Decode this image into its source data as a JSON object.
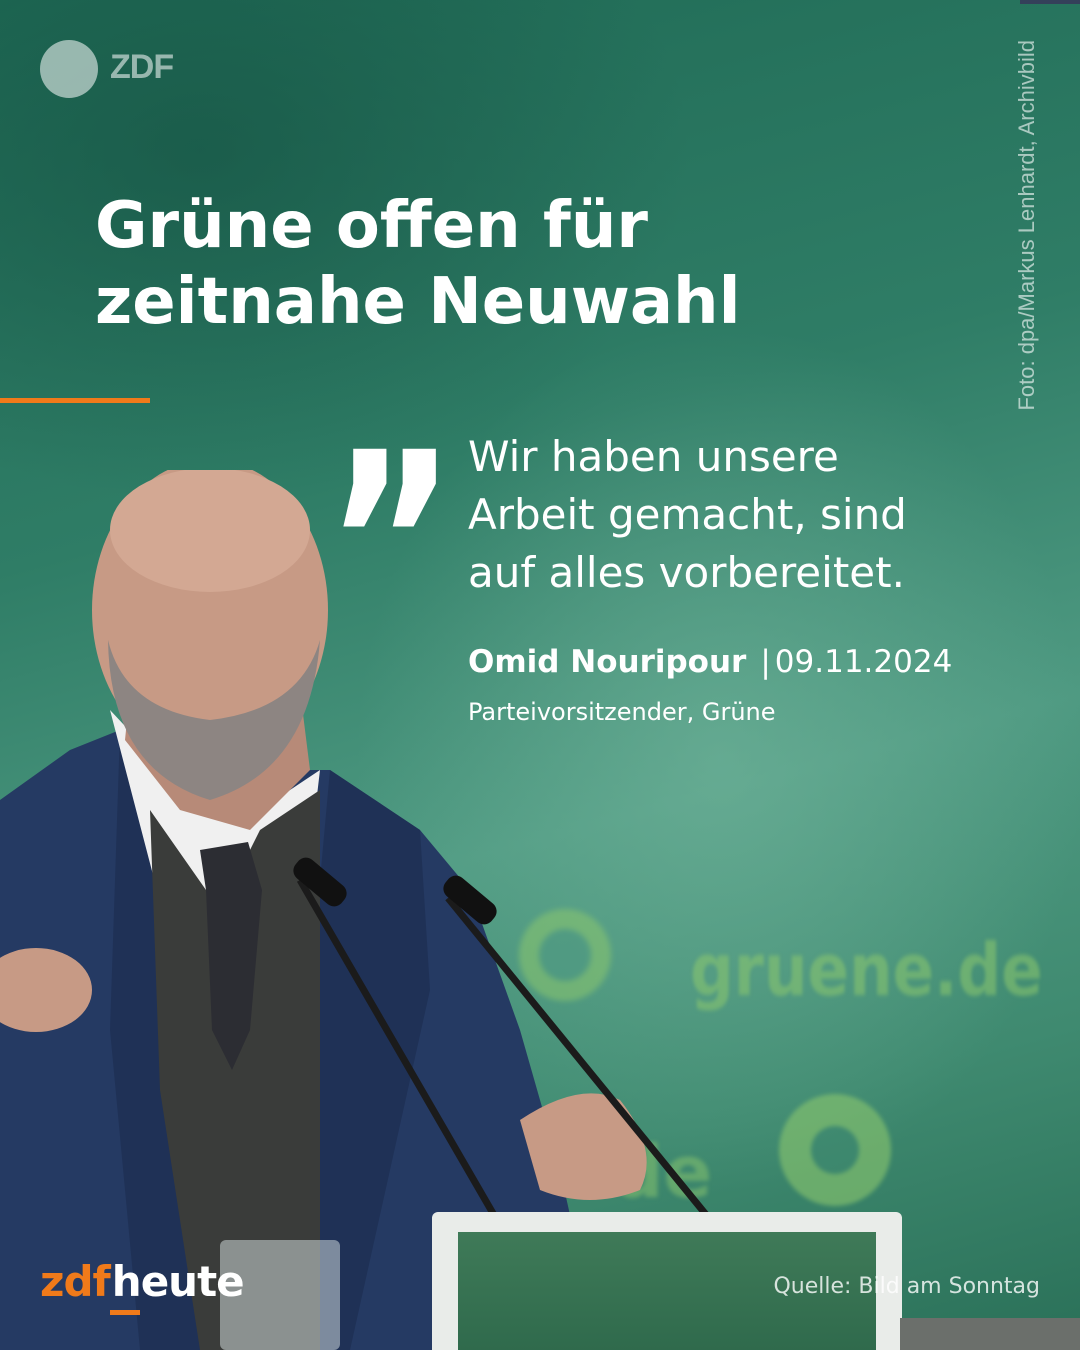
{
  "logo": {
    "letters": "ZDF"
  },
  "photo_credit": "Foto: dpa/Markus Lenhardt, Archivbild",
  "headline": {
    "line1": "Grüne offen für",
    "line2": "zeitnahe Neuwahl"
  },
  "quote": {
    "mark": "”",
    "line1": "Wir haben unsere",
    "line2": "Arbeit gemacht, sind",
    "line3": "auf alles vorbereitet."
  },
  "speaker": {
    "name": "Omid Nouripour",
    "separator": "|",
    "date": "09.11.2024",
    "role": "Parteivorsitzender, Grüne"
  },
  "background_signage": {
    "text": "gruene.de",
    "text2": "de"
  },
  "brand": {
    "part1": "zdf",
    "part2": "heute"
  },
  "source": "Quelle: Bild am Sonntag",
  "colors": {
    "accent": "#f07a1a",
    "background": "#2f7d66",
    "text": "#ffffff"
  }
}
